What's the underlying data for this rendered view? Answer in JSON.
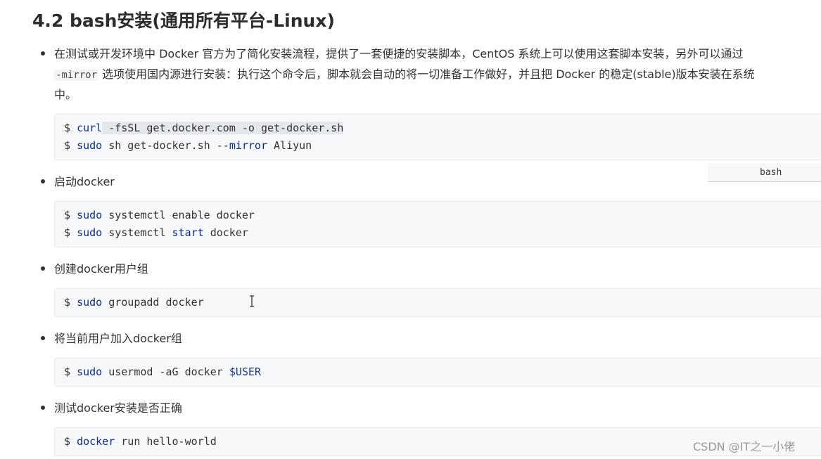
{
  "heading": "4.2 bash安装(通用所有平台-Linux)",
  "intro": {
    "line1": "在测试或开发环境中 Docker 官方为了简化安装流程，提供了一套便捷的安装脚本，CentOS 系统上可以使用这套脚本安装，另外可以通过",
    "line2_code": "-mirror",
    "line2_text": " 选项使用国内源进行安装：执行这个命令后，脚本就会自动的将一切准备工作做好，并且把 Docker 的稳定(stable)版本安装在系统",
    "line3": "中。"
  },
  "block1": {
    "line1": {
      "prompt": "$ ",
      "cmd": "curl",
      "args": " -fsSL get.docker.com -o get-docker.sh"
    },
    "line2": {
      "prompt": "$ ",
      "cmd": "sudo",
      "mid": " sh get-docker.sh --",
      "kw2": "mirror",
      "tail": " Aliyun"
    }
  },
  "bash_tag": "bash",
  "step2": {
    "label": "启动docker",
    "line1": {
      "prompt": "$ ",
      "cmd": "sudo",
      "args": " systemctl enable docker"
    },
    "line2": {
      "prompt": "$ ",
      "cmd": "sudo",
      "mid": " systemctl ",
      "kw2": "start",
      "tail": " docker"
    }
  },
  "step3": {
    "label": "创建docker用户组",
    "line1": {
      "prompt": "$ ",
      "cmd": "sudo",
      "args": " groupadd docker"
    }
  },
  "step4": {
    "label": "将当前用户加入docker组",
    "line1": {
      "prompt": "$ ",
      "cmd": "sudo",
      "args": " usermod -aG docker ",
      "var": "$USER"
    }
  },
  "step5": {
    "label": "测试docker安装是否正确",
    "line1": {
      "prompt": "$ ",
      "cmd": "docker",
      "args": " run hello-world"
    }
  },
  "watermark": "CSDN @IT之一小佬",
  "colors": {
    "keyword": "#0a2e8f",
    "code_bg": "#f6f8fa",
    "text": "#333333"
  }
}
